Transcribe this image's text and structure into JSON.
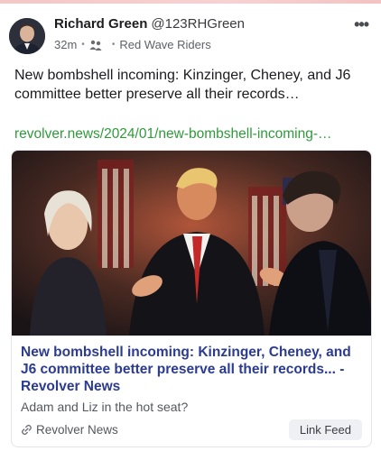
{
  "post": {
    "author_name": "Richard Green",
    "author_handle": "@123RHGreen",
    "time": "32m",
    "group": "Red Wave Riders",
    "more_label": "•••",
    "text": "New bombshell incoming: Kinzinger, Cheney, and J6 committee better preserve all their records…",
    "link_text": "revolver.news/2024/01/new-bombshell-incoming-…"
  },
  "card": {
    "title": "New bombshell incoming: Kinzinger, Cheney, and J6 committee better preserve all their records... - Revolver News",
    "description": "Adam and Liz in the hot seat?",
    "source": "Revolver News",
    "action_label": "Link Feed"
  },
  "icons": {
    "more": "more-horizontal-icon",
    "group": "group-icon",
    "link": "link-icon"
  },
  "colors": {
    "link_green": "#2f9a3a",
    "card_title_blue": "#2b3b8f"
  }
}
